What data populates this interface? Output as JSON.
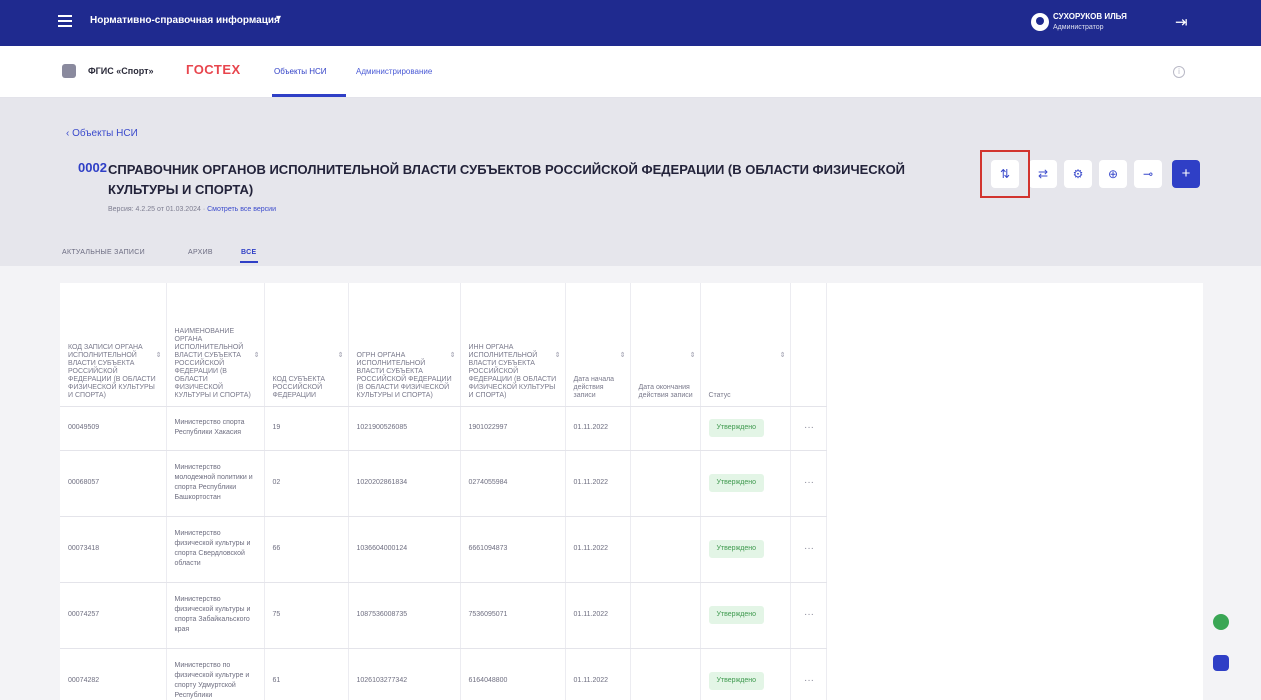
{
  "topbar": {
    "title": "Нормативно-справочная информация",
    "caret": "▾",
    "user_name": "СУХОРУКОВ ИЛЬЯ",
    "user_role": "Администратор",
    "logout_glyph": "⇥"
  },
  "apphead": {
    "brand": "ФГИС «Спорт»",
    "gostech": "ГОСТЕХ",
    "tabs": [
      "Объекты НСИ",
      "Администрирование"
    ],
    "info_glyph": "i"
  },
  "page": {
    "breadcrumb": "‹  Объекты НСИ",
    "code": "0002",
    "heading": "СПРАВОЧНИК ОРГАНОВ ИСПОЛНИТЕЛЬНОЙ ВЛАСТИ СУБЪЕКТОВ РОССИЙСКОЙ ФЕДЕРАЦИИ (В ОБЛАСТИ ФИЗИЧЕСКОЙ КУЛЬТУРЫ И СПОРТА)",
    "version_text": "Версия: 4.2.25 от 01.03.2024 ·",
    "version_link": "Смотреть все версии",
    "subtabs": [
      "АКТУАЛЬНЫЕ ЗАПИСИ",
      "АРХИВ",
      "ВСЕ"
    ],
    "actions": [
      "⇅",
      "⇄",
      "⚙",
      "⊕",
      "⊸",
      "+"
    ]
  },
  "table": {
    "headers": [
      "КОД ЗАПИСИ ОРГАНА ИСПОЛНИТЕЛЬНОЙ ВЛАСТИ СУБЪЕКТА РОССИЙСКОЙ ФЕДЕРАЦИИ (В ОБЛАСТИ ФИЗИЧЕСКОЙ КУЛЬТУРЫ И СПОРТА)",
      "НАИМЕНОВАНИЕ ОРГАНА ИСПОЛНИТЕЛЬНОЙ ВЛАСТИ СУБЪЕКТА РОССИЙСКОЙ ФЕДЕРАЦИИ (В ОБЛАСТИ ФИЗИЧЕСКОЙ КУЛЬТУРЫ И СПОРТА)",
      "КОД СУБЪЕКТА РОССИЙСКОЙ ФЕДЕРАЦИИ",
      "ОГРН ОРГАНА ИСПОЛНИТЕЛЬНОЙ ВЛАСТИ СУБЪЕКТА РОССИЙСКОЙ ФЕДЕРАЦИИ (В ОБЛАСТИ ФИЗИЧЕСКОЙ КУЛЬТУРЫ И СПОРТА)",
      "ИНН ОРГАНА ИСПОЛНИТЕЛЬНОЙ ВЛАСТИ СУБЪЕКТА РОССИЙСКОЙ ФЕДЕРАЦИИ (В ОБЛАСТИ ФИЗИЧЕСКОЙ КУЛЬТУРЫ И СПОРТА)",
      "Дата начала действия записи",
      "Дата окончания действия записи",
      "Статус",
      ""
    ],
    "sort_glyph": "⇕",
    "rows": [
      {
        "code": "00049509",
        "name": "Министерство спорта Республики Хакасия",
        "region": "19",
        "ogrn": "1021900526085",
        "inn": "1901022997",
        "start": "01.11.2022",
        "end": "",
        "status": "Утверждено",
        "menu": "···"
      },
      {
        "code": "00068057",
        "name": "Министерство молодежной политики и спорта Республики Башкортостан",
        "region": "02",
        "ogrn": "1020202861834",
        "inn": "0274055984",
        "start": "01.11.2022",
        "end": "",
        "status": "Утверждено",
        "menu": "···"
      },
      {
        "code": "00073418",
        "name": "Министерство физической культуры и спорта Свердловской области",
        "region": "66",
        "ogrn": "1036604000124",
        "inn": "6661094873",
        "start": "01.11.2022",
        "end": "",
        "status": "Утверждено",
        "menu": "···"
      },
      {
        "code": "00074257",
        "name": "Министерство физической культуры и спорта Забайкальского края",
        "region": "75",
        "ogrn": "1087536008735",
        "inn": "7536095071",
        "start": "01.11.2022",
        "end": "",
        "status": "Утверждено",
        "menu": "···"
      },
      {
        "code": "00074282",
        "name": "Министерство по физической культуре и спорту Удмуртской Республики",
        "region": "61",
        "ogrn": "1026103277342",
        "inn": "6164048800",
        "start": "01.11.2022",
        "end": "",
        "status": "Утверждено",
        "menu": "···"
      }
    ]
  }
}
